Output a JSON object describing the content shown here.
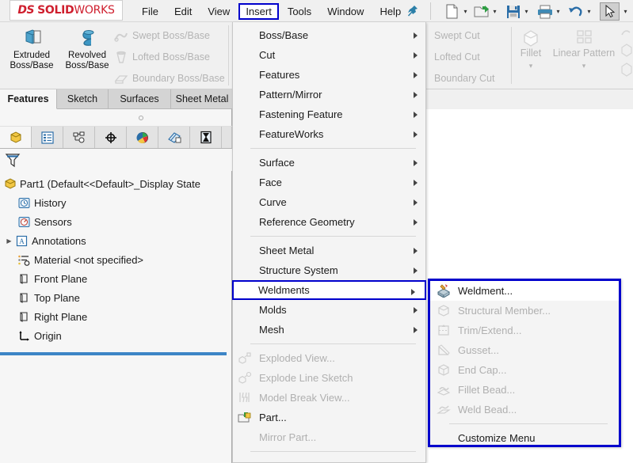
{
  "app": {
    "brand_ds": "DS",
    "brand_solid": "SOLID",
    "brand_works": "WORKS",
    "accent_red": "#cf1f2e",
    "highlight_blue": "#0000cc",
    "rollback_blue": "#3d85c6"
  },
  "menubar": {
    "items": [
      {
        "label": "File",
        "active": false
      },
      {
        "label": "Edit",
        "active": false
      },
      {
        "label": "View",
        "active": false
      },
      {
        "label": "Insert",
        "active": true
      },
      {
        "label": "Tools",
        "active": false
      },
      {
        "label": "Window",
        "active": false
      },
      {
        "label": "Help",
        "active": false
      }
    ],
    "pin_icon": "pushpin-icon",
    "quick_access": [
      {
        "name": "new-document-icon",
        "has_dropdown": true
      },
      {
        "name": "open-folder-icon",
        "has_dropdown": true
      },
      {
        "name": "save-icon",
        "has_dropdown": true
      },
      {
        "name": "print-icon",
        "has_dropdown": true
      },
      {
        "name": "undo-icon",
        "has_dropdown": true
      },
      {
        "name": "select-cursor-icon",
        "has_dropdown": true
      }
    ]
  },
  "ribbon": {
    "big_buttons": [
      {
        "label_line1": "Extruded",
        "label_line2": "Boss/Base",
        "icon": "extruded-boss-icon"
      },
      {
        "label_line1": "Revolved",
        "label_line2": "Boss/Base",
        "icon": "revolved-boss-icon"
      }
    ],
    "boss_list": [
      {
        "label": "Swept Boss/Base",
        "icon": "swept-boss-icon",
        "disabled": true
      },
      {
        "label": "Lofted Boss/Base",
        "icon": "lofted-boss-icon",
        "disabled": true
      },
      {
        "label": "Boundary Boss/Base",
        "icon": "boundary-boss-icon",
        "disabled": true
      }
    ],
    "cut_list": [
      {
        "label": "Swept Cut",
        "disabled": true
      },
      {
        "label": "Lofted Cut",
        "disabled": true
      },
      {
        "label": "Boundary Cut",
        "disabled": true
      }
    ],
    "groups": [
      {
        "label": "Fillet",
        "icon": "fillet-icon",
        "disabled": true,
        "has_dropdown": true
      },
      {
        "label": "Linear Pattern",
        "icon": "linear-pattern-icon",
        "disabled": true,
        "has_dropdown": true
      }
    ]
  },
  "tabs": [
    {
      "label": "Features",
      "selected": true
    },
    {
      "label": "Sketch",
      "selected": false
    },
    {
      "label": "Surfaces",
      "selected": false
    },
    {
      "label": "Sheet Metal",
      "selected": false
    }
  ],
  "panel_tabs": [
    {
      "name": "feature-manager-icon",
      "selected": true
    },
    {
      "name": "property-manager-icon",
      "selected": false
    },
    {
      "name": "configuration-manager-icon",
      "selected": false
    },
    {
      "name": "dimxpert-manager-icon",
      "selected": false
    },
    {
      "name": "display-manager-icon",
      "selected": false
    },
    {
      "name": "appearance-icon",
      "selected": false
    },
    {
      "name": "simulation-icon",
      "selected": false
    }
  ],
  "filter": {
    "icon": "filter-funnel-icon"
  },
  "tree": {
    "root": {
      "label": "Part1  (Default<<Default>_Display State",
      "icon": "part-icon"
    },
    "items": [
      {
        "label": "History",
        "icon": "history-icon",
        "expandable": false
      },
      {
        "label": "Sensors",
        "icon": "sensors-icon",
        "expandable": false
      },
      {
        "label": "Annotations",
        "icon": "annotations-icon",
        "expandable": true
      },
      {
        "label": "Material <not specified>",
        "icon": "material-icon",
        "expandable": false
      },
      {
        "label": "Front Plane",
        "icon": "plane-icon",
        "expandable": false
      },
      {
        "label": "Top Plane",
        "icon": "plane-icon",
        "expandable": false
      },
      {
        "label": "Right Plane",
        "icon": "plane-icon",
        "expandable": false
      },
      {
        "label": "Origin",
        "icon": "origin-icon",
        "expandable": false
      }
    ]
  },
  "insert_menu": {
    "items": [
      {
        "label": "Boss/Base",
        "submenu": true,
        "disabled": false,
        "highlighted": false,
        "icon": null
      },
      {
        "label": "Cut",
        "submenu": true,
        "disabled": false,
        "highlighted": false,
        "icon": null
      },
      {
        "label": "Features",
        "submenu": true,
        "disabled": false,
        "highlighted": false,
        "icon": null
      },
      {
        "label": "Pattern/Mirror",
        "submenu": true,
        "disabled": false,
        "highlighted": false,
        "icon": null
      },
      {
        "label": "Fastening Feature",
        "submenu": true,
        "disabled": false,
        "highlighted": false,
        "icon": null
      },
      {
        "label": "FeatureWorks",
        "submenu": true,
        "disabled": false,
        "highlighted": false,
        "icon": null
      },
      {
        "separator": true
      },
      {
        "label": "Surface",
        "submenu": true,
        "disabled": false,
        "highlighted": false,
        "icon": null
      },
      {
        "label": "Face",
        "submenu": true,
        "disabled": false,
        "highlighted": false,
        "icon": null
      },
      {
        "label": "Curve",
        "submenu": true,
        "disabled": false,
        "highlighted": false,
        "icon": null
      },
      {
        "label": "Reference Geometry",
        "submenu": true,
        "disabled": false,
        "highlighted": false,
        "icon": null
      },
      {
        "separator": true
      },
      {
        "label": "Sheet Metal",
        "submenu": true,
        "disabled": false,
        "highlighted": false,
        "icon": null
      },
      {
        "label": "Structure System",
        "submenu": true,
        "disabled": false,
        "highlighted": false,
        "icon": null
      },
      {
        "label": "Weldments",
        "submenu": true,
        "disabled": false,
        "highlighted": true,
        "icon": null
      },
      {
        "label": "Molds",
        "submenu": true,
        "disabled": false,
        "highlighted": false,
        "icon": null
      },
      {
        "label": "Mesh",
        "submenu": true,
        "disabled": false,
        "highlighted": false,
        "icon": null
      },
      {
        "separator": true
      },
      {
        "label": "Exploded View...",
        "submenu": false,
        "disabled": true,
        "highlighted": false,
        "icon": "exploded-view-icon"
      },
      {
        "label": "Explode Line Sketch",
        "submenu": false,
        "disabled": true,
        "highlighted": false,
        "icon": "explode-line-sketch-icon"
      },
      {
        "label": "Model Break View...",
        "submenu": false,
        "disabled": true,
        "highlighted": false,
        "icon": "model-break-view-icon"
      },
      {
        "label": "Part...",
        "submenu": false,
        "disabled": false,
        "highlighted": false,
        "icon": "insert-part-icon"
      },
      {
        "label": "Mirror Part...",
        "submenu": false,
        "disabled": true,
        "highlighted": false,
        "icon": null
      },
      {
        "separator": true
      }
    ]
  },
  "weldments_submenu": {
    "items": [
      {
        "label": "Weldment...",
        "disabled": false,
        "selected": true,
        "icon": "weldment-icon"
      },
      {
        "label": "Structural Member...",
        "disabled": true,
        "selected": false,
        "icon": "structural-member-icon"
      },
      {
        "label": "Trim/Extend...",
        "disabled": true,
        "selected": false,
        "icon": "trim-extend-icon"
      },
      {
        "label": "Gusset...",
        "disabled": true,
        "selected": false,
        "icon": "gusset-icon"
      },
      {
        "label": "End Cap...",
        "disabled": true,
        "selected": false,
        "icon": "end-cap-icon"
      },
      {
        "label": "Fillet Bead...",
        "disabled": true,
        "selected": false,
        "icon": "fillet-bead-icon"
      },
      {
        "label": "Weld Bead...",
        "disabled": true,
        "selected": false,
        "icon": "weld-bead-icon"
      },
      {
        "separator": true
      },
      {
        "label": "Customize Menu",
        "disabled": false,
        "selected": false,
        "icon": null
      }
    ]
  }
}
